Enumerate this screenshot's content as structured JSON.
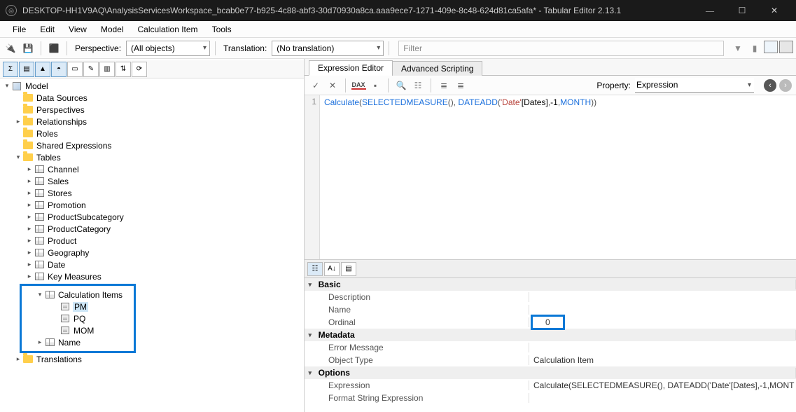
{
  "titlebar": {
    "title": "DESKTOP-HH1V9AQ\\AnalysisServicesWorkspace_bcab0e77-b925-4c88-abf3-30d70930a8ca.aaa9ece7-1271-409e-8c48-624d81ca5afa* - Tabular Editor 2.13.1"
  },
  "menu": [
    "File",
    "Edit",
    "View",
    "Model",
    "Calculation Item",
    "Tools"
  ],
  "toolbar1": {
    "perspective_label": "Perspective:",
    "perspective_value": "(All objects)",
    "translation_label": "Translation:",
    "translation_value": "(No translation)",
    "filter_placeholder": "Filter"
  },
  "tree": {
    "root": "Model",
    "items": [
      "Data Sources",
      "Perspectives",
      "Relationships",
      "Roles",
      "Shared Expressions"
    ],
    "tables_label": "Tables",
    "tables": [
      "Channel",
      "Sales",
      "Stores",
      "Promotion",
      "ProductSubcategory",
      "ProductCategory",
      "Product",
      "Geography",
      "Date",
      "Key Measures"
    ],
    "calc_group_label": "Calculation Items",
    "calc_items": [
      "PM",
      "PQ",
      "MOM"
    ],
    "calc_extra": "Name",
    "translations": "Translations"
  },
  "tabs": {
    "a": "Expression Editor",
    "b": "Advanced Scripting"
  },
  "exprbar": {
    "property_label": "Property:",
    "property_value": "Expression"
  },
  "code": {
    "line_no": "1",
    "tokens": {
      "calc": "Calculate",
      "selmeas": "SELECTEDMEASURE",
      "dateadd": "DATEADD",
      "tableref": "'Date'",
      "colref": "[Dates]",
      "neg1": "-1",
      "month": "MONTH"
    }
  },
  "props": {
    "basic": "Basic",
    "description": "Description",
    "name": "Name",
    "ordinal": "Ordinal",
    "ordinal_val": "0",
    "metadata": "Metadata",
    "errmsg": "Error Message",
    "objtype": "Object Type",
    "objtype_val": "Calculation Item",
    "options": "Options",
    "expression": "Expression",
    "expression_val": "Calculate(SELECTEDMEASURE(), DATEADD('Date'[Dates],-1,MONT",
    "format": "Format String Expression"
  }
}
